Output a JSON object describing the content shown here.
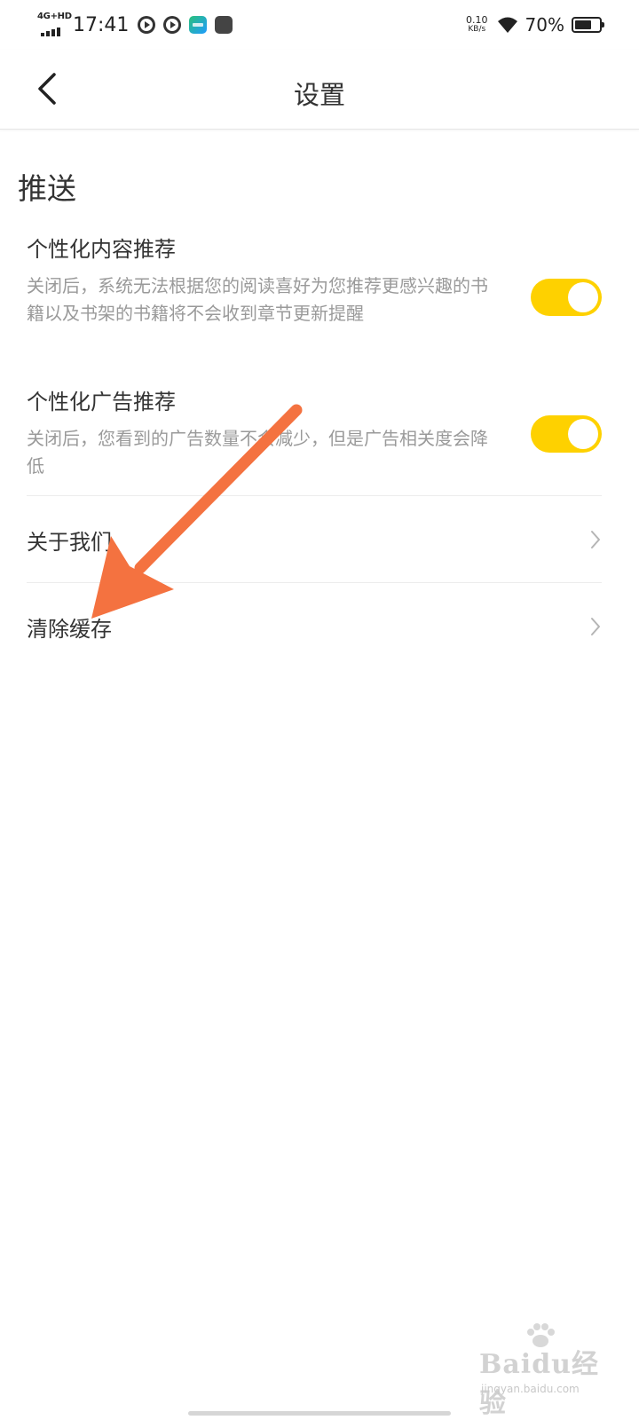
{
  "status_bar": {
    "network": "4G+HD",
    "time": "17:41",
    "speed_value": "0.10",
    "speed_unit": "KB/s",
    "battery_percent": "70%",
    "battery_level": 0.7
  },
  "header": {
    "title": "设置"
  },
  "section": {
    "title": "推送"
  },
  "settings": [
    {
      "title": "个性化内容推荐",
      "description": "关闭后，系统无法根据您的阅读喜好为您推荐更感兴趣的书籍以及书架的书籍将不会收到章节更新提醒",
      "enabled": true
    },
    {
      "title": "个性化广告推荐",
      "description": "关闭后，您看到的广告数量不会减少，但是广告相关度会降低",
      "enabled": true
    }
  ],
  "nav_items": [
    {
      "label": "关于我们"
    },
    {
      "label": "清除缓存"
    }
  ],
  "colors": {
    "toggle_on": "#fed100",
    "annotation_arrow": "#f47240"
  },
  "watermark": {
    "main": "Baidu经验",
    "sub": "jingyan.baidu.com"
  }
}
